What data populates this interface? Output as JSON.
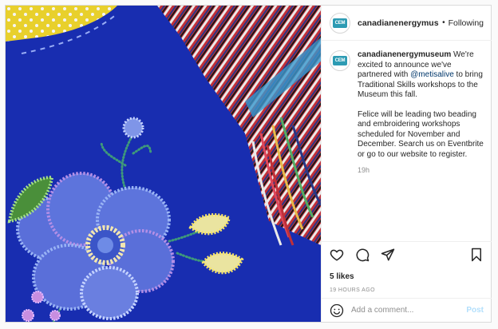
{
  "post": {
    "image": {
      "description": "Blue felt with colourful glass-bead floral embroidery, yellow polka-dot fabric and braided woven sash fringe",
      "colors": {
        "felt": "#1a2fb8",
        "flower_outline": "#8fb0f0",
        "flower_center": "#f2e6b0",
        "leaf_green": "#7dbb6a",
        "polka_yellow": "#f2d92e"
      }
    },
    "header": {
      "username": "canadianenergymuseum",
      "separator": "•",
      "follow_label": "Following",
      "avatar_text": "CEM",
      "avatar_color": "#2d9bb3"
    },
    "caption": {
      "username": "canadianenergymuseum",
      "text_before_mention": "We're excited to announce we've partnered with",
      "mention": "@metisalive",
      "text_after_mention": "to bring Traditional Skills workshops to the Museum this fall.",
      "paragraph2": "Felice will be leading two beading and embroidering workshops scheduled for November and December. Search us on Eventbrite or go to our website to register.",
      "time": "19h"
    },
    "likes": "5 likes",
    "posted_ago": "19 HOURS AGO",
    "comment_box": {
      "placeholder": "Add a comment...",
      "post_label": "Post"
    }
  }
}
